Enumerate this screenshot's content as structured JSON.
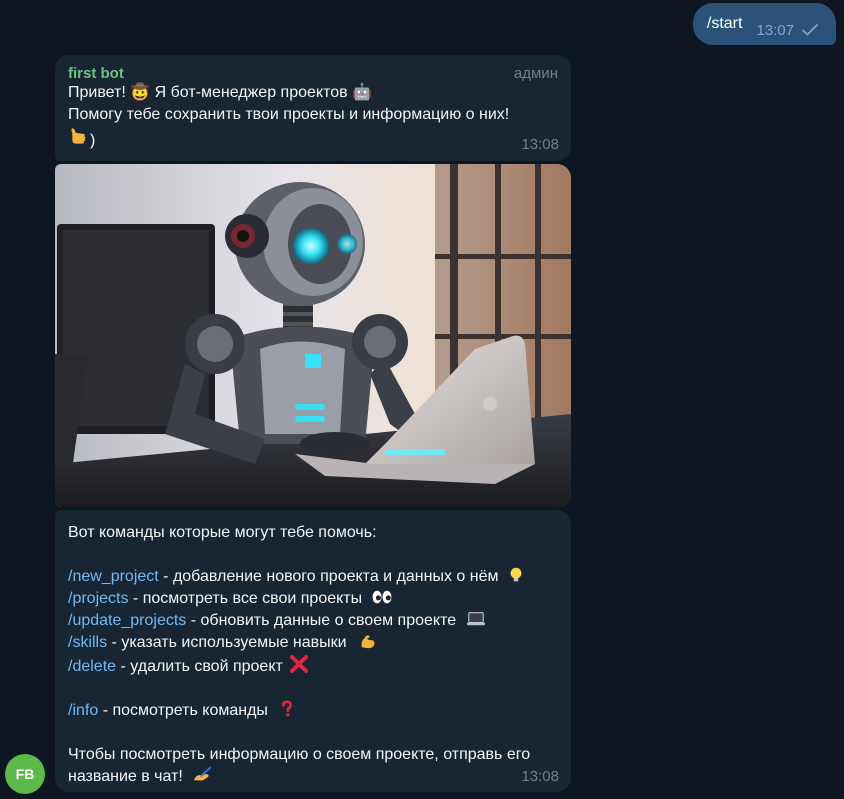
{
  "outgoing": {
    "text": "/start",
    "time": "13:07"
  },
  "greeting": {
    "sender": "first bot",
    "role": "админ",
    "line1": "Привет! 🤠 Я бот-менеджер проектов 🤖",
    "line2": "Помогу тебе сохранить твои проекты и информацию о них!",
    "line3": ")",
    "time": "13:08"
  },
  "commands_message": {
    "intro": "Вот команды которые могут тебе помочь:",
    "items": [
      {
        "cmd": "/new_project",
        "desc": " - добавление нового проекта и данных о нём",
        "icon": "lightbulb-icon"
      },
      {
        "cmd": "/projects",
        "desc": " - посмотреть все свои проекты",
        "icon": "eyes-icon"
      },
      {
        "cmd": "/update_projects",
        "desc": " - обновить данные о своем проекте",
        "icon": "laptop-icon"
      },
      {
        "cmd": "/skills",
        "desc": " - указать используемые навыки",
        "icon": "muscle-icon"
      },
      {
        "cmd": "/delete",
        "desc": " - удалить свой проект",
        "icon": "cross-icon"
      }
    ],
    "info": {
      "cmd": "/info",
      "desc": " - посмотреть команды",
      "icon": "question-icon"
    },
    "outro1": "Чтобы посмотреть информацию о своем проекте, отправь его",
    "outro2": "название в чат!",
    "time": "13:08"
  },
  "avatar": {
    "initials": "FB",
    "color": "#5cb94a"
  }
}
